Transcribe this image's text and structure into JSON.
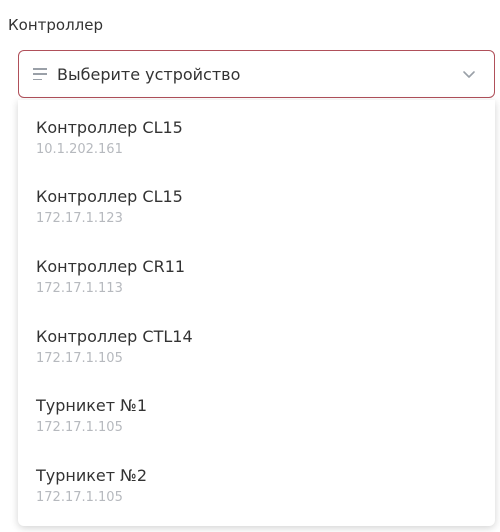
{
  "field": {
    "label": "Контроллер"
  },
  "select": {
    "placeholder": "Выберите устройство",
    "leading_icon": "lines-icon",
    "trailing_icon": "chevron-down-icon",
    "border_color": "#b0505a"
  },
  "options": [
    {
      "name": "Контроллер CL15",
      "ip": "10.1.202.161"
    },
    {
      "name": "Контроллер CL15",
      "ip": "172.17.1.123"
    },
    {
      "name": "Контроллер CR11",
      "ip": "172.17.1.113"
    },
    {
      "name": "Контроллер CTL14",
      "ip": "172.17.1.105"
    },
    {
      "name": "Турникет №1",
      "ip": "172.17.1.105"
    },
    {
      "name": "Турникет №2",
      "ip": "172.17.1.105"
    }
  ]
}
